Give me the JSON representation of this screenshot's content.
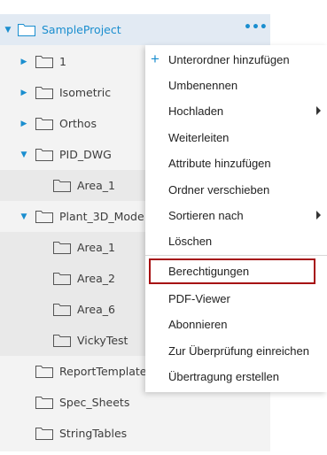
{
  "tree": {
    "root": {
      "label": "SampleProject"
    },
    "items": [
      {
        "label": "1"
      },
      {
        "label": "Isometric"
      },
      {
        "label": "Orthos"
      },
      {
        "label": "PID_DWG"
      },
      {
        "label": "Area_1"
      },
      {
        "label": "Plant_3D_Mode"
      },
      {
        "label": "Area_1"
      },
      {
        "label": "Area_2"
      },
      {
        "label": "Area_6"
      },
      {
        "label": "VickyTest"
      },
      {
        "label": "ReportTemplate"
      },
      {
        "label": "Spec_Sheets"
      },
      {
        "label": "StringTables"
      }
    ]
  },
  "menu": {
    "items": [
      "Unterordner hinzufügen",
      "Umbenennen",
      "Hochladen",
      "Weiterleiten",
      "Attribute hinzufügen",
      "Ordner verschieben",
      "Sortieren nach",
      "Löschen",
      "Berechtigungen",
      "PDF-Viewer",
      "Abonnieren",
      "Zur Überprüfung einreichen",
      "Übertragung erstellen"
    ]
  },
  "colors": {
    "accent": "#1a8ecf",
    "highlight_border": "#a60f12"
  }
}
